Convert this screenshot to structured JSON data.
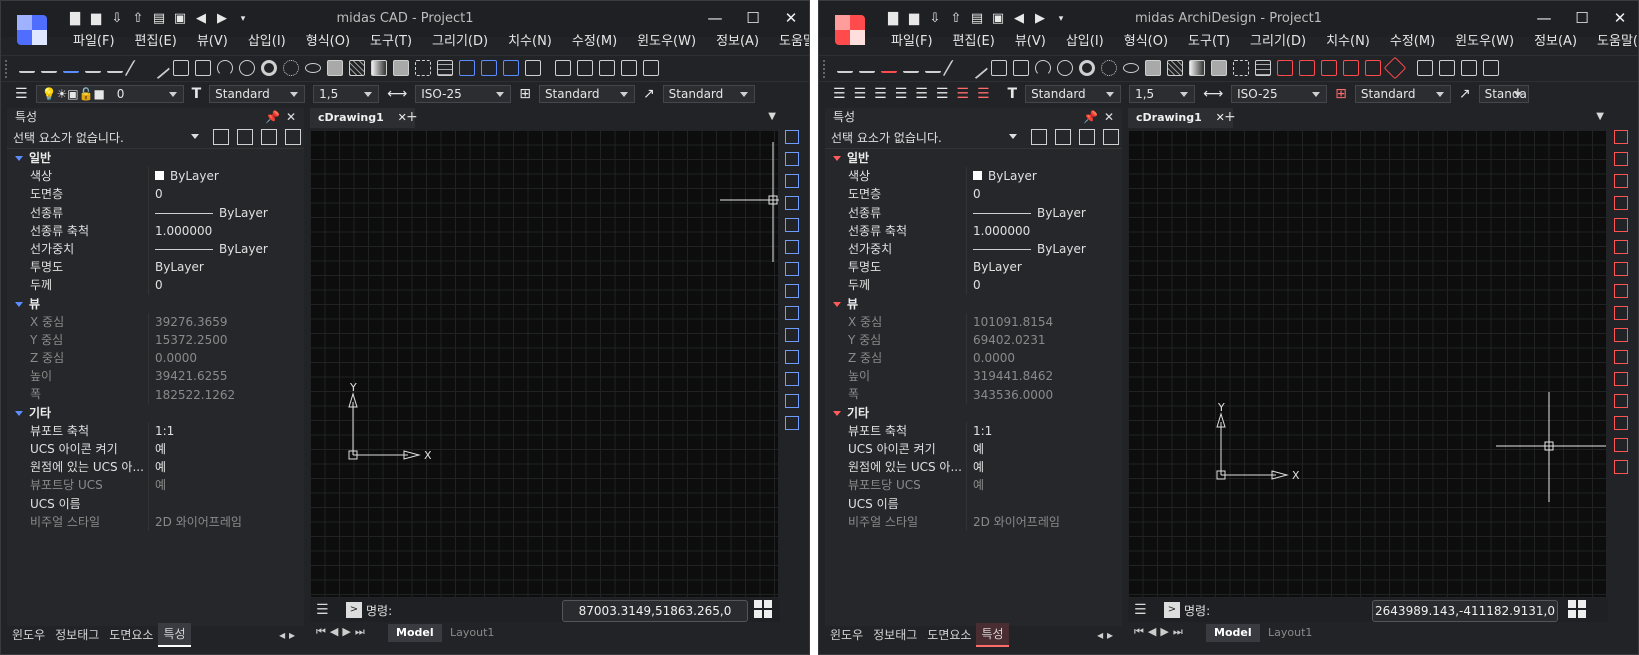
{
  "windows": [
    {
      "id": "left",
      "title": "midas CAD - Project1",
      "logo_color": "#4f6dff",
      "menus": [
        "파일(F)",
        "편집(E)",
        "뷰(V)",
        "삽입(I)",
        "형식(O)",
        "도구(T)",
        "그리기(D)",
        "치수(N)",
        "수정(M)",
        "윈도우(W)",
        "정보(A)",
        "도움말(H)"
      ],
      "toolbar2": {
        "layer_value": "0",
        "text_style": "Standard",
        "line_weight": "1,5",
        "dim_style": "ISO-25",
        "table_style": "Standard",
        "mleader_style": "Standard"
      },
      "properties": {
        "header": "특성",
        "selection": "선택 요소가 없습니다.",
        "groups": [
          {
            "name": "일반",
            "rows": [
              {
                "key": "색상",
                "value": "ByLayer",
                "kind": "swatch"
              },
              {
                "key": "도면층",
                "value": "0"
              },
              {
                "key": "선종류",
                "value": "ByLayer",
                "kind": "line"
              },
              {
                "key": "선종류 축척",
                "value": "1.000000"
              },
              {
                "key": "선가중치",
                "value": "ByLayer",
                "kind": "line"
              },
              {
                "key": "투명도",
                "value": "ByLayer"
              },
              {
                "key": "두께",
                "value": "0"
              }
            ]
          },
          {
            "name": "뷰",
            "rows": [
              {
                "key": "X 중심",
                "value": "39276.3659",
                "dim": true
              },
              {
                "key": "Y 중심",
                "value": "15372.2500",
                "dim": true
              },
              {
                "key": "Z 중심",
                "value": "0.0000",
                "dim": true
              },
              {
                "key": "높이",
                "value": "39421.6255",
                "dim": true
              },
              {
                "key": "폭",
                "value": "182522.1262",
                "dim": true
              }
            ]
          },
          {
            "name": "기타",
            "rows": [
              {
                "key": "뷰포트 축척",
                "value": "1:1"
              },
              {
                "key": "UCS 아이콘 켜기",
                "value": "예"
              },
              {
                "key": "원점에 있는 UCS 아...",
                "value": "예"
              },
              {
                "key": "뷰포트당 UCS",
                "value": "예",
                "dim": true
              },
              {
                "key": "UCS 이름",
                "value": ""
              },
              {
                "key": "비주얼 스타일",
                "value": "2D 와이어프레임",
                "dim": true
              }
            ]
          }
        ],
        "tabs": [
          "윈도우",
          "정보태그",
          "도면요소",
          "특성"
        ],
        "active_tab": "특성"
      },
      "doc_tab": "cDrawing1",
      "ucs": {
        "x": "X",
        "y": "Y"
      },
      "command_label": "명령:",
      "coordinates": "87003.3149,51863.265,0",
      "layout_tabs": {
        "model": "Model",
        "layout": "Layout1"
      }
    },
    {
      "id": "right",
      "title": "midas ArchiDesign - Project1",
      "logo_color": "#ff4b4b",
      "menus": [
        "파일(F)",
        "편집(E)",
        "뷰(V)",
        "삽입(I)",
        "형식(O)",
        "도구(T)",
        "그리기(D)",
        "치수(N)",
        "수정(M)",
        "윈도우(W)",
        "정보(A)",
        "도움말(H)"
      ],
      "toolbar2": {
        "text_style": "Standard",
        "line_weight": "1,5",
        "dim_style": "ISO-25",
        "table_style": "Standard",
        "mleader_style": "Standa"
      },
      "properties": {
        "header": "특성",
        "selection": "선택 요소가 없습니다.",
        "groups": [
          {
            "name": "일반",
            "rows": [
              {
                "key": "색상",
                "value": "ByLayer",
                "kind": "swatch"
              },
              {
                "key": "도면층",
                "value": "0"
              },
              {
                "key": "선종류",
                "value": "ByLayer",
                "kind": "line"
              },
              {
                "key": "선종류 축척",
                "value": "1.000000"
              },
              {
                "key": "선가중치",
                "value": "ByLayer",
                "kind": "line"
              },
              {
                "key": "투명도",
                "value": "ByLayer"
              },
              {
                "key": "두께",
                "value": "0"
              }
            ]
          },
          {
            "name": "뷰",
            "rows": [
              {
                "key": "X 중심",
                "value": "101091.8154",
                "dim": true
              },
              {
                "key": "Y 중심",
                "value": "69402.0231",
                "dim": true
              },
              {
                "key": "Z 중심",
                "value": "0.0000",
                "dim": true
              },
              {
                "key": "높이",
                "value": "319441.8462",
                "dim": true
              },
              {
                "key": "폭",
                "value": "343536.0000",
                "dim": true
              }
            ]
          },
          {
            "name": "기타",
            "rows": [
              {
                "key": "뷰포트 축척",
                "value": "1:1"
              },
              {
                "key": "UCS 아이콘 켜기",
                "value": "예"
              },
              {
                "key": "원점에 있는 UCS 아...",
                "value": "예"
              },
              {
                "key": "뷰포트당 UCS",
                "value": "예",
                "dim": true
              },
              {
                "key": "UCS 이름",
                "value": ""
              },
              {
                "key": "비주얼 스타일",
                "value": "2D 와이어프레임",
                "dim": true
              }
            ]
          }
        ],
        "tabs": [
          "윈도우",
          "정보태그",
          "도면요소",
          "특성"
        ],
        "active_tab": "특성"
      },
      "doc_tab": "cDrawing1",
      "ucs": {
        "x": "X",
        "y": "Y"
      },
      "command_label": "명령:",
      "coordinates": "2643989.143,-411182.9131,0",
      "layout_tabs": {
        "model": "Model",
        "layout": "Layout1"
      }
    }
  ]
}
